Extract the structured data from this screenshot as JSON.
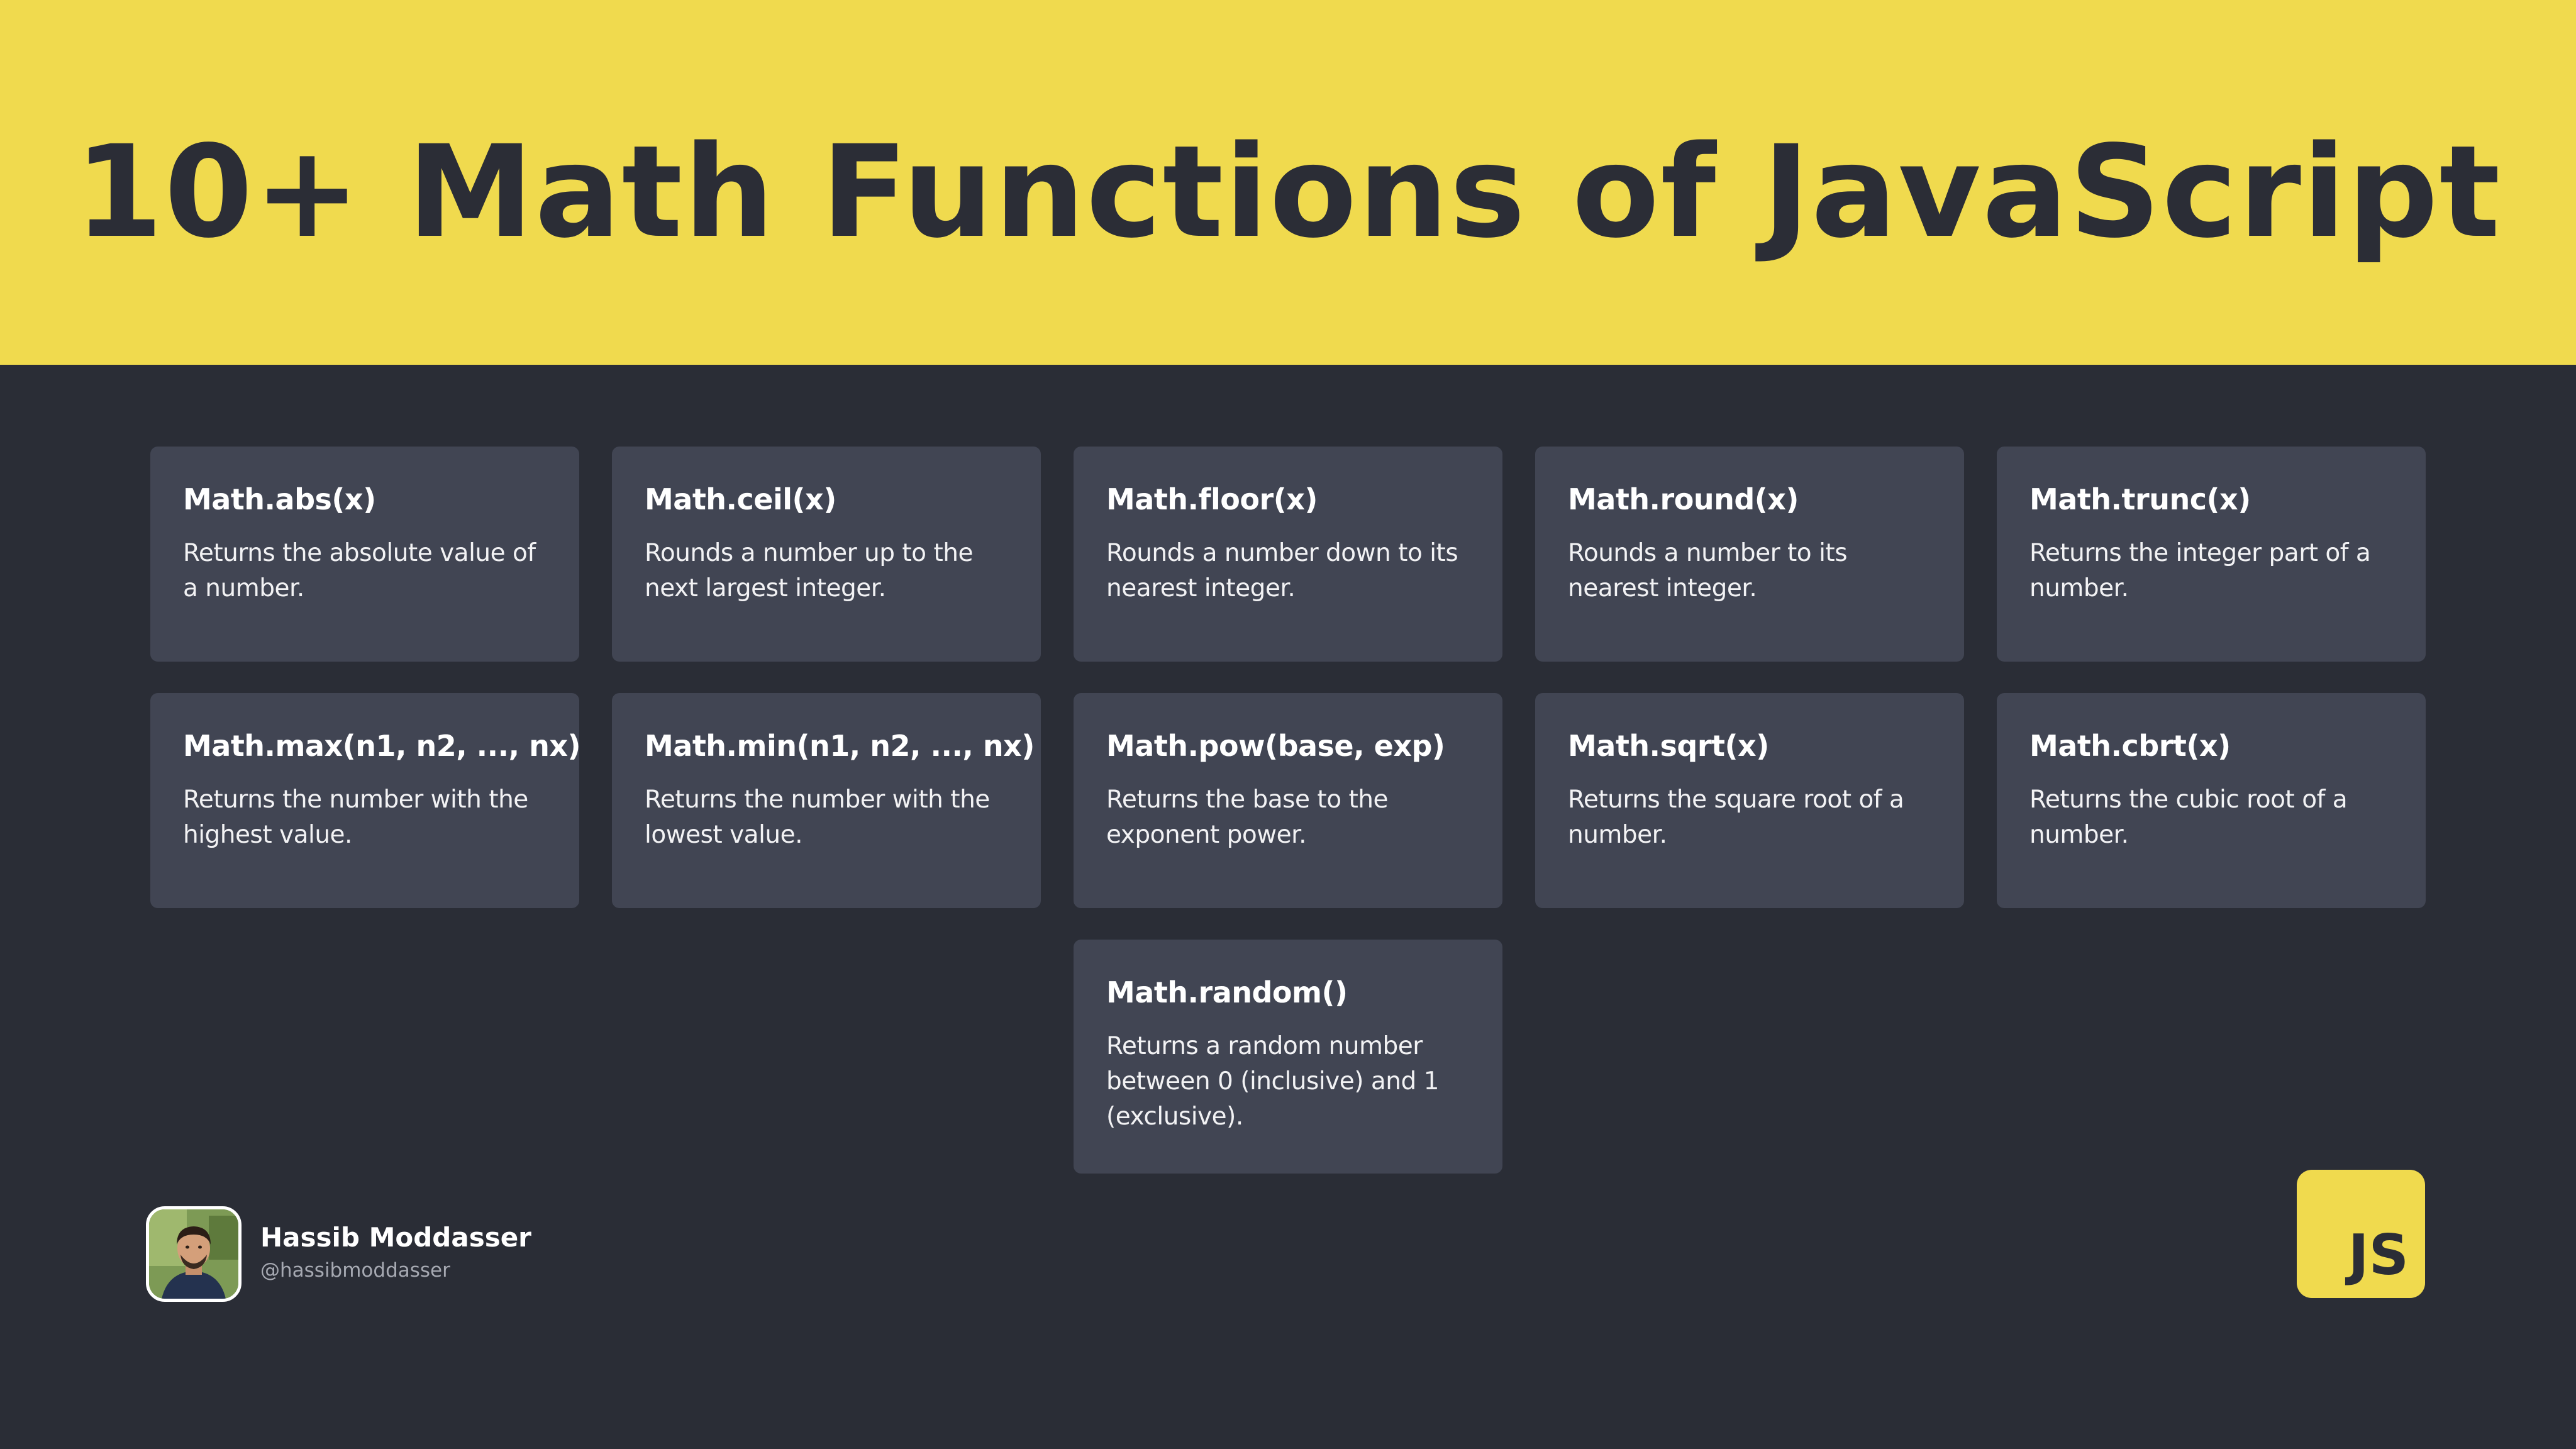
{
  "title": "10+ Math Functions of JavaScript",
  "cards": [
    {
      "name": "Math.abs(x)",
      "desc": "Returns the absolute value of a number."
    },
    {
      "name": "Math.ceil(x)",
      "desc": "Rounds a number up to the next largest integer."
    },
    {
      "name": "Math.floor(x)",
      "desc": "Rounds a number down to its nearest integer."
    },
    {
      "name": "Math.round(x)",
      "desc": "Rounds a number to its nearest integer."
    },
    {
      "name": "Math.trunc(x)",
      "desc": "Returns the integer part of a number."
    },
    {
      "name": "Math.max(n1, n2, ..., nx)",
      "desc": "Returns the number with the highest value."
    },
    {
      "name": "Math.min(n1, n2, ..., nx)",
      "desc": "Returns the number with the lowest value."
    },
    {
      "name": "Math.pow(base, exp)",
      "desc": "Returns the base to the exponent power."
    },
    {
      "name": "Math.sqrt(x)",
      "desc": "Returns the square root of a number."
    },
    {
      "name": "Math.cbrt(x)",
      "desc": "Returns the cubic root of a number."
    },
    {
      "name": "Math.random()",
      "desc": "Returns a random number between 0 (inclusive) and 1 (exclusive)."
    }
  ],
  "author": {
    "name": "Hassib Moddasser",
    "handle": "@hassibmoddasser"
  },
  "logo": {
    "text": "JS"
  },
  "colors": {
    "accent": "#f0da4e",
    "background": "#2a2d36",
    "card": "#414553",
    "text_dark": "#2b2d36"
  }
}
